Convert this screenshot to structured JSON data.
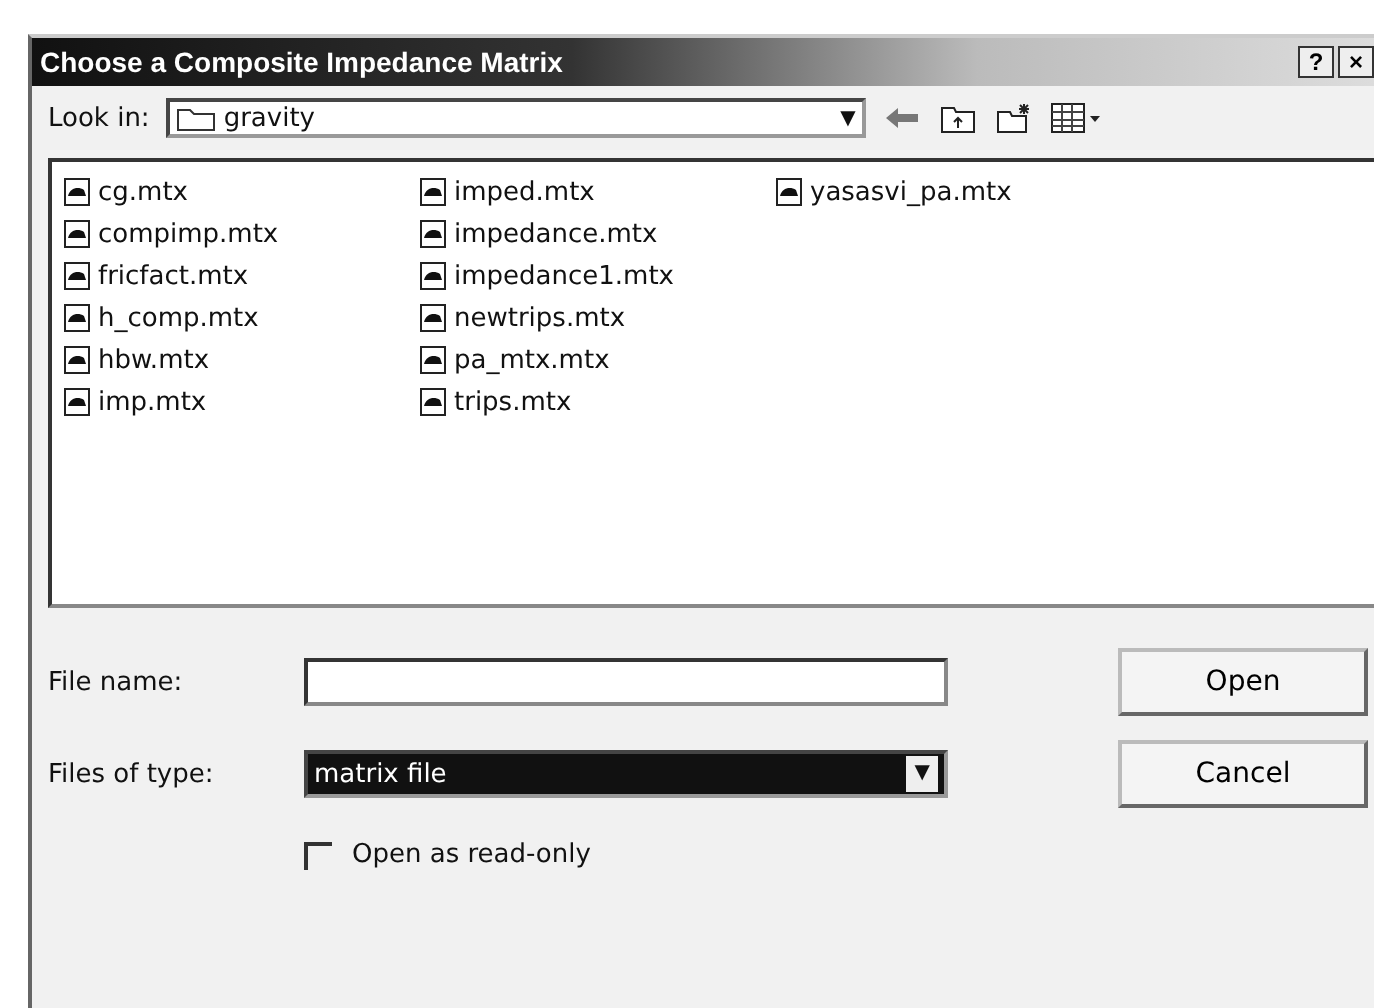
{
  "window": {
    "title": "Choose a Composite Impedance Matrix",
    "help_button": "?",
    "close_button": "×"
  },
  "look_in": {
    "label": "Look in:",
    "value": "gravity",
    "arrow": "▼"
  },
  "files": [
    {
      "name": "cg.mtx"
    },
    {
      "name": "compimp.mtx"
    },
    {
      "name": "fricfact.mtx"
    },
    {
      "name": "h_comp.mtx"
    },
    {
      "name": "hbw.mtx"
    },
    {
      "name": "imp.mtx"
    },
    {
      "name": "imped.mtx"
    },
    {
      "name": "impedance.mtx"
    },
    {
      "name": "impedance1.mtx"
    },
    {
      "name": "newtrips.mtx"
    },
    {
      "name": "pa_mtx.mtx"
    },
    {
      "name": "trips.mtx"
    },
    {
      "name": "yasasvi_pa.mtx"
    }
  ],
  "file_name": {
    "label": "File name:"
  },
  "files_of_type": {
    "label": "Files of type:",
    "value": "matrix file",
    "arrow": "▼"
  },
  "read_only": {
    "label": "Open as read-only",
    "checked": false
  },
  "buttons": [
    "Open",
    "Cancel"
  ]
}
